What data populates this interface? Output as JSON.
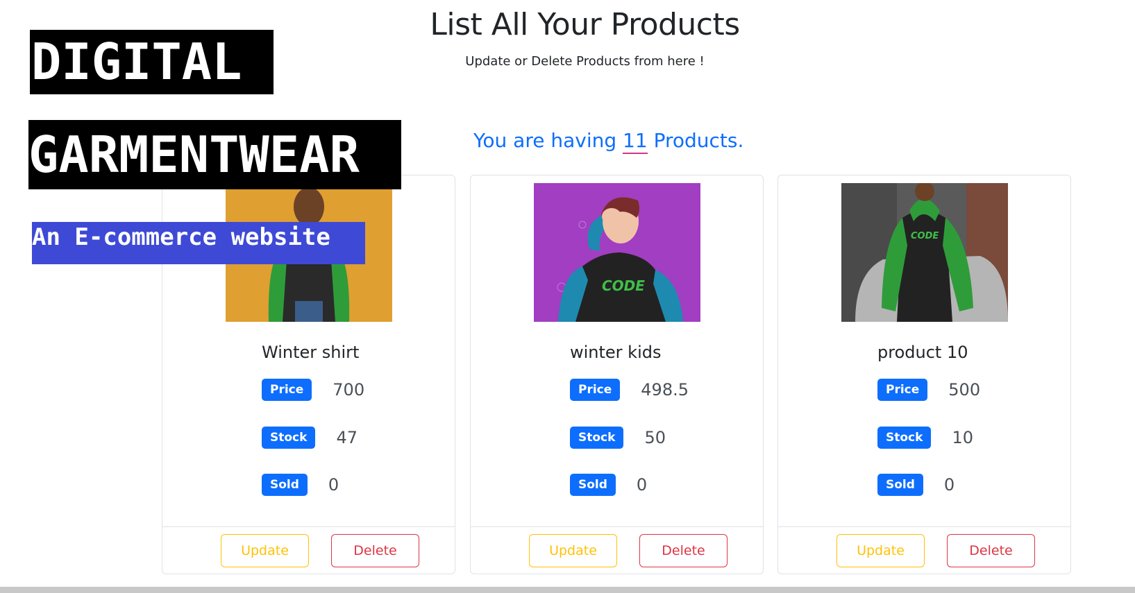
{
  "header": {
    "title": "List All Your Products",
    "subtitle": "Update or Delete Products from here !"
  },
  "summary": {
    "prefix": "You are having",
    "count": "11",
    "suffix": "Products."
  },
  "overlay": {
    "brand_line1": "DIGITAL",
    "brand_line2": "GARMENTWEAR",
    "tagline": "An E-commerce website"
  },
  "labels": {
    "price": "Price",
    "stock": "Stock",
    "sold": "Sold",
    "update": "Update",
    "delete": "Delete"
  },
  "products": [
    {
      "name": "Winter shirt",
      "price": "700",
      "stock": "47",
      "sold": "0",
      "image_icon": "man-green-sleeve-shirt-photo"
    },
    {
      "name": "winter kids",
      "price": "498.5",
      "stock": "50",
      "sold": "0",
      "image_icon": "woman-code-tshirt-photo"
    },
    {
      "name": "product 10",
      "price": "500",
      "stock": "10",
      "sold": "0",
      "image_icon": "green-hoodie-car-photo"
    }
  ],
  "colors": {
    "primary": "#0d6efd",
    "warning": "#ffc107",
    "danger": "#dc3545",
    "tagline_bg": "#3e4ad6"
  }
}
